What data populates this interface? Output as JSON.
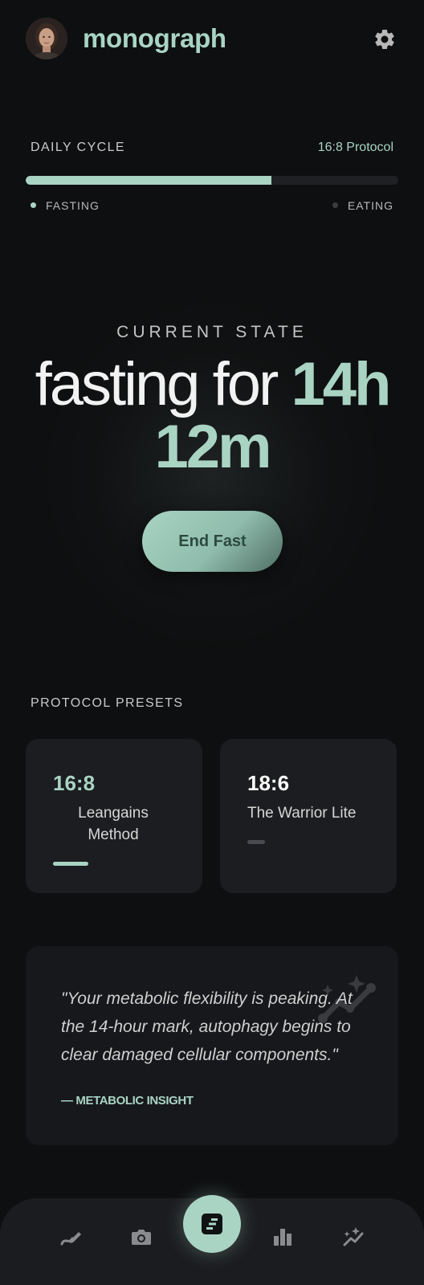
{
  "header": {
    "brand": "monograph",
    "avatar_icon": "user-avatar",
    "settings_icon": "gear-icon"
  },
  "cycle": {
    "label": "DAILY CYCLE",
    "protocol": "16:8 Protocol",
    "progress": 0.66,
    "legend_fasting": "FASTING",
    "legend_eating": "EATING"
  },
  "hero": {
    "label": "CURRENT STATE",
    "prefix": "fasting for",
    "duration": "14h 12m",
    "end_button": "End Fast"
  },
  "presets": {
    "label": "PROTOCOL PRESETS",
    "items": [
      {
        "ratio": "16:8",
        "name": "Leangains Method"
      },
      {
        "ratio": "18:6",
        "name": "The Warrior Lite"
      }
    ]
  },
  "insight": {
    "quote": "\"Your metabolic flexibility is peaking. At the 14-hour mark, autophagy begins to clear damaged cellular components.\"",
    "attribution": "— METABOLIC INSIGHT",
    "icon": "sparkle-trend-icon"
  },
  "nav": {
    "items": [
      "log-icon",
      "camera-icon",
      "journal-icon",
      "stats-icon",
      "insights-icon"
    ],
    "active": "journal-icon"
  },
  "colors": {
    "accent": "#a9d4c4",
    "background": "#0e0f10",
    "card": "#1c1d20"
  }
}
